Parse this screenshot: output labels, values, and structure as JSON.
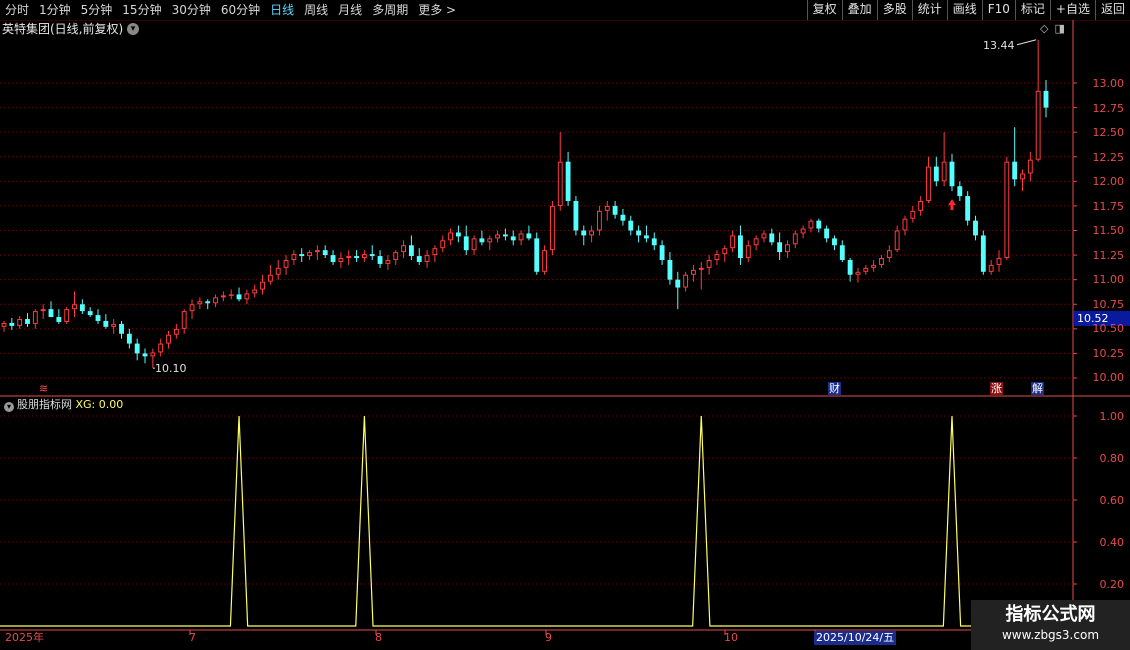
{
  "toolbar": {
    "periods": [
      "分时",
      "1分钟",
      "5分钟",
      "15分钟",
      "30分钟",
      "60分钟",
      "日线",
      "周线",
      "月线",
      "多周期",
      "更多 >"
    ],
    "tools": [
      "复权",
      "叠加",
      "多股",
      "统计",
      "画线",
      "F10",
      "标记",
      "+自选",
      "返回"
    ]
  },
  "main": {
    "title": "英特集团(日线,前复权)",
    "current_price": "10.52",
    "high_label": "13.44",
    "low_label": "10.10",
    "markers": {
      "left": "≋",
      "cai": "财",
      "zhang": "涨",
      "jie": "解"
    }
  },
  "indicator": {
    "name": "股朋指标网",
    "xg_label": "XG: 0.00"
  },
  "dates": {
    "d0": "2025年",
    "d1": "7",
    "d2": "8",
    "d3": "9",
    "d4": "10",
    "selected": "2025/10/24/五"
  },
  "watermark": {
    "line1": "指标公式网",
    "line2": "www.zbgs3.com"
  },
  "colors": {
    "up": "#ff3b3b",
    "down": "#54ffff",
    "grid": "#7a0000",
    "axis": "#e84a4a",
    "signal": "#ffff60"
  },
  "chart_data": {
    "type": "candlestick",
    "price_axis": {
      "ylim": [
        10.0,
        13.0
      ],
      "ticks": [
        "13.00",
        "12.75",
        "12.50",
        "12.25",
        "12.00",
        "11.75",
        "11.50",
        "11.25",
        "11.00",
        "10.75",
        "10.50",
        "10.25",
        "10.00"
      ]
    },
    "indicator_axis": {
      "ylim": [
        0,
        1
      ],
      "ticks": [
        "1.00",
        "0.80",
        "0.60",
        "0.40",
        "0.20"
      ]
    },
    "signal_positions": [
      30,
      46,
      89,
      121
    ],
    "ohlc": [
      [
        10.52,
        10.58,
        10.47,
        10.56
      ],
      [
        10.56,
        10.61,
        10.49,
        10.53
      ],
      [
        10.53,
        10.63,
        10.5,
        10.6
      ],
      [
        10.6,
        10.66,
        10.52,
        10.55
      ],
      [
        10.55,
        10.7,
        10.5,
        10.68
      ],
      [
        10.68,
        10.75,
        10.6,
        10.7
      ],
      [
        10.7,
        10.78,
        10.65,
        10.62
      ],
      [
        10.62,
        10.7,
        10.55,
        10.57
      ],
      [
        10.57,
        10.72,
        10.55,
        10.7
      ],
      [
        10.7,
        10.88,
        10.62,
        10.75
      ],
      [
        10.75,
        10.8,
        10.65,
        10.68
      ],
      [
        10.68,
        10.72,
        10.62,
        10.64
      ],
      [
        10.64,
        10.7,
        10.55,
        10.58
      ],
      [
        10.58,
        10.65,
        10.5,
        10.52
      ],
      [
        10.52,
        10.6,
        10.45,
        10.55
      ],
      [
        10.55,
        10.58,
        10.4,
        10.45
      ],
      [
        10.45,
        10.5,
        10.3,
        10.35
      ],
      [
        10.35,
        10.4,
        10.18,
        10.25
      ],
      [
        10.25,
        10.3,
        10.15,
        10.22
      ],
      [
        10.22,
        10.3,
        10.1,
        10.26
      ],
      [
        10.26,
        10.4,
        10.22,
        10.35
      ],
      [
        10.35,
        10.48,
        10.3,
        10.44
      ],
      [
        10.44,
        10.55,
        10.4,
        10.5
      ],
      [
        10.5,
        10.7,
        10.45,
        10.68
      ],
      [
        10.68,
        10.8,
        10.6,
        10.75
      ],
      [
        10.75,
        10.82,
        10.7,
        10.78
      ],
      [
        10.78,
        10.8,
        10.7,
        10.76
      ],
      [
        10.76,
        10.85,
        10.72,
        10.82
      ],
      [
        10.82,
        10.88,
        10.78,
        10.84
      ],
      [
        10.84,
        10.9,
        10.8,
        10.85
      ],
      [
        10.85,
        10.92,
        10.78,
        10.8
      ],
      [
        10.8,
        10.9,
        10.75,
        10.86
      ],
      [
        10.86,
        10.95,
        10.82,
        10.9
      ],
      [
        10.9,
        11.05,
        10.85,
        10.98
      ],
      [
        10.98,
        11.15,
        10.95,
        11.05
      ],
      [
        11.05,
        11.2,
        11.0,
        11.12
      ],
      [
        11.12,
        11.25,
        11.05,
        11.2
      ],
      [
        11.2,
        11.3,
        11.15,
        11.26
      ],
      [
        11.26,
        11.32,
        11.18,
        11.24
      ],
      [
        11.24,
        11.3,
        11.2,
        11.28
      ],
      [
        11.28,
        11.35,
        11.2,
        11.3
      ],
      [
        11.3,
        11.35,
        11.22,
        11.25
      ],
      [
        11.25,
        11.3,
        11.15,
        11.18
      ],
      [
        11.18,
        11.28,
        11.12,
        11.22
      ],
      [
        11.22,
        11.3,
        11.15,
        11.24
      ],
      [
        11.24,
        11.3,
        11.18,
        11.22
      ],
      [
        11.22,
        11.3,
        11.18,
        11.26
      ],
      [
        11.26,
        11.35,
        11.2,
        11.24
      ],
      [
        11.24,
        11.3,
        11.12,
        11.16
      ],
      [
        11.16,
        11.25,
        11.1,
        11.2
      ],
      [
        11.2,
        11.3,
        11.15,
        11.28
      ],
      [
        11.28,
        11.4,
        11.22,
        11.35
      ],
      [
        11.35,
        11.45,
        11.2,
        11.24
      ],
      [
        11.24,
        11.32,
        11.15,
        11.18
      ],
      [
        11.18,
        11.3,
        11.12,
        11.25
      ],
      [
        11.25,
        11.35,
        11.18,
        11.32
      ],
      [
        11.32,
        11.45,
        11.28,
        11.4
      ],
      [
        11.4,
        11.52,
        11.35,
        11.48
      ],
      [
        11.48,
        11.55,
        11.38,
        11.44
      ],
      [
        11.44,
        11.55,
        11.25,
        11.3
      ],
      [
        11.3,
        11.45,
        11.25,
        11.42
      ],
      [
        11.42,
        11.5,
        11.35,
        11.38
      ],
      [
        11.38,
        11.45,
        11.3,
        11.42
      ],
      [
        11.42,
        11.5,
        11.38,
        11.46
      ],
      [
        11.46,
        11.52,
        11.4,
        11.44
      ],
      [
        11.44,
        11.5,
        11.35,
        11.4
      ],
      [
        11.4,
        11.5,
        11.35,
        11.47
      ],
      [
        11.47,
        11.55,
        11.4,
        11.42
      ],
      [
        11.42,
        11.48,
        11.05,
        11.08
      ],
      [
        11.08,
        11.35,
        11.05,
        11.3
      ],
      [
        11.3,
        11.8,
        11.25,
        11.75
      ],
      [
        11.75,
        12.5,
        11.7,
        12.2
      ],
      [
        12.2,
        12.3,
        11.75,
        11.8
      ],
      [
        11.8,
        11.85,
        11.45,
        11.5
      ],
      [
        11.5,
        11.55,
        11.35,
        11.45
      ],
      [
        11.45,
        11.55,
        11.38,
        11.5
      ],
      [
        11.5,
        11.75,
        11.45,
        11.7
      ],
      [
        11.7,
        11.8,
        11.6,
        11.75
      ],
      [
        11.75,
        11.8,
        11.62,
        11.66
      ],
      [
        11.66,
        11.72,
        11.55,
        11.6
      ],
      [
        11.6,
        11.65,
        11.45,
        11.5
      ],
      [
        11.5,
        11.55,
        11.38,
        11.45
      ],
      [
        11.45,
        11.55,
        11.38,
        11.42
      ],
      [
        11.42,
        11.48,
        11.3,
        11.35
      ],
      [
        11.35,
        11.4,
        11.15,
        11.2
      ],
      [
        11.2,
        11.28,
        10.95,
        11.0
      ],
      [
        11.0,
        11.08,
        10.7,
        10.92
      ],
      [
        10.92,
        11.08,
        10.88,
        11.05
      ],
      [
        11.05,
        11.15,
        10.98,
        11.1
      ],
      [
        11.1,
        11.18,
        10.9,
        11.12
      ],
      [
        11.12,
        11.25,
        11.05,
        11.2
      ],
      [
        11.2,
        11.3,
        11.15,
        11.26
      ],
      [
        11.26,
        11.35,
        11.18,
        11.32
      ],
      [
        11.32,
        11.5,
        11.28,
        11.45
      ],
      [
        11.45,
        11.55,
        11.15,
        11.22
      ],
      [
        11.22,
        11.4,
        11.18,
        11.35
      ],
      [
        11.35,
        11.45,
        11.3,
        11.42
      ],
      [
        11.42,
        11.5,
        11.38,
        11.47
      ],
      [
        11.47,
        11.52,
        11.35,
        11.38
      ],
      [
        11.38,
        11.48,
        11.2,
        11.28
      ],
      [
        11.28,
        11.4,
        11.22,
        11.36
      ],
      [
        11.36,
        11.5,
        11.32,
        11.47
      ],
      [
        11.47,
        11.55,
        11.42,
        11.52
      ],
      [
        11.52,
        11.62,
        11.48,
        11.6
      ],
      [
        11.6,
        11.62,
        11.48,
        11.52
      ],
      [
        11.52,
        11.55,
        11.38,
        11.42
      ],
      [
        11.42,
        11.45,
        11.3,
        11.35
      ],
      [
        11.35,
        11.4,
        11.18,
        11.2
      ],
      [
        11.2,
        11.22,
        10.98,
        11.05
      ],
      [
        11.05,
        11.12,
        10.97,
        11.08
      ],
      [
        11.08,
        11.15,
        11.05,
        11.12
      ],
      [
        11.12,
        11.2,
        11.08,
        11.15
      ],
      [
        11.15,
        11.25,
        11.12,
        11.22
      ],
      [
        11.22,
        11.35,
        11.18,
        11.3
      ],
      [
        11.3,
        11.55,
        11.28,
        11.5
      ],
      [
        11.5,
        11.65,
        11.45,
        11.62
      ],
      [
        11.62,
        11.75,
        11.58,
        11.7
      ],
      [
        11.7,
        11.85,
        11.65,
        11.8
      ],
      [
        11.8,
        12.25,
        11.78,
        12.15
      ],
      [
        12.15,
        12.25,
        11.95,
        12.0
      ],
      [
        12.0,
        12.5,
        11.95,
        12.2
      ],
      [
        12.2,
        12.28,
        11.9,
        11.95
      ],
      [
        11.95,
        12.0,
        11.8,
        11.85
      ],
      [
        11.85,
        11.9,
        11.55,
        11.6
      ],
      [
        11.6,
        11.65,
        11.4,
        11.45
      ],
      [
        11.45,
        11.5,
        11.05,
        11.08
      ],
      [
        11.08,
        11.2,
        11.05,
        11.15
      ],
      [
        11.15,
        11.3,
        11.08,
        11.22
      ],
      [
        11.22,
        12.25,
        11.2,
        12.2
      ],
      [
        12.2,
        12.55,
        11.95,
        12.02
      ],
      [
        12.02,
        12.12,
        11.9,
        12.08
      ],
      [
        12.08,
        12.3,
        12.0,
        12.22
      ],
      [
        12.22,
        13.44,
        12.2,
        12.92
      ],
      [
        12.92,
        13.03,
        12.65,
        12.75
      ]
    ]
  }
}
